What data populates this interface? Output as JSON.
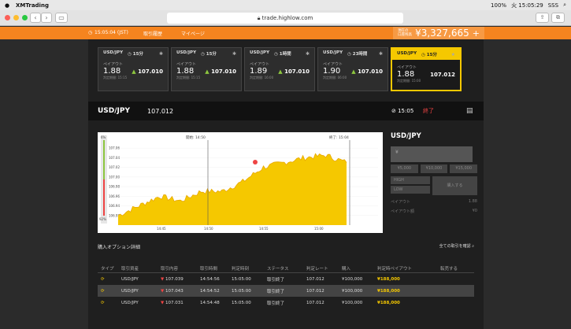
{
  "mac": {
    "app_name": "XMTrading",
    "status_battery": "100%",
    "status_date": "火 15:05:29",
    "status_user": "SSS"
  },
  "browser": {
    "url": "trade.highlow.com"
  },
  "topbar": {
    "time": "15:05:04 (JST)",
    "history": "取引履歴",
    "mypage": "マイページ",
    "balance_label_1": "現在の",
    "balance_label_2": "口座残高",
    "balance_value": "¥3,327,665",
    "add": "+"
  },
  "cards": [
    {
      "pair": "USD/JPY",
      "period": "15分",
      "label": "ペイアウト",
      "payout": "1.88",
      "rate": "107.010",
      "sub": "判定期間: 15:15"
    },
    {
      "pair": "USD/JPY",
      "period": "15分",
      "label": "ペイアウト",
      "payout": "1.88",
      "rate": "107.010",
      "sub": "判定期間: 15:15"
    },
    {
      "pair": "USD/JPY",
      "period": "1時間",
      "label": "ペイアウト",
      "payout": "1.89",
      "rate": "107.010",
      "sub": "判定期間: 16:00"
    },
    {
      "pair": "USD/JPY",
      "period": "23時間",
      "label": "ペイアウト",
      "payout": "1.90",
      "rate": "107.010",
      "sub": "判定期間: 06:00"
    },
    {
      "pair": "USD/JPY",
      "period": "15分",
      "label": "ペイアウト",
      "payout": "1.88",
      "rate": "107.012",
      "sub": "判定期間: 15:00"
    }
  ],
  "pairbar": {
    "pair": "USD/JPY",
    "rate": "107.012",
    "time": "15:05",
    "status": "終了"
  },
  "chart": {
    "start_label": "開始: 14:50",
    "end_label": "終了: 15:04",
    "pct_top": "6%",
    "pct_bottom": "92%",
    "y_ticks": [
      "107.06",
      "107.04",
      "107.02",
      "107.00",
      "106.98",
      "106.96",
      "106.94",
      "106.92"
    ],
    "x_ticks": [
      "14:45",
      "14:50",
      "14:55",
      "15:00"
    ]
  },
  "chart_data": {
    "type": "area",
    "x": [
      "14:42",
      "14:44",
      "14:46",
      "14:48",
      "14:50",
      "14:52",
      "14:54",
      "14:56",
      "14:58",
      "15:00",
      "15:02",
      "15:04"
    ],
    "y": [
      106.92,
      106.94,
      106.96,
      106.95,
      106.97,
      106.97,
      106.99,
      107.02,
      107.03,
      107.04,
      107.045,
      107.03
    ],
    "yticks": [
      "107.06",
      "107.04",
      "107.02",
      "107.00",
      "106.98",
      "106.96",
      "106.94",
      "106.92"
    ],
    "ylim": [
      106.9,
      107.07
    ]
  },
  "side": {
    "title": "USD/JPY",
    "placeholder": "¥",
    "amounts": [
      "¥5,000",
      "¥10,000",
      "¥15,000"
    ],
    "high": "HIGH",
    "low": "LOW",
    "buy": "購入する",
    "payout_label": "ペイアウト",
    "payout_value": "1.88",
    "max_label": "ペイアウト額",
    "max_value": "¥0"
  },
  "section": {
    "title": "購入オプション詳細",
    "link": "全ての取引を確認"
  },
  "table": {
    "headers": [
      "タイプ",
      "取引資産",
      "取引内容",
      "取引時間",
      "判定時刻",
      "ステータス",
      "判定レート",
      "購入",
      "判定時ペイアウト",
      "転売する"
    ],
    "rows": [
      {
        "asset": "USD/JPY",
        "content": "107.039",
        "time": "14:54:56",
        "judge": "15:05:00",
        "status": "取引終了",
        "rate": "107.012",
        "buy": "¥100,000",
        "payout": "¥188,000"
      },
      {
        "asset": "USD/JPY",
        "content": "107.043",
        "time": "14:54:52",
        "judge": "15:05:00",
        "status": "取引終了",
        "rate": "107.012",
        "buy": "¥100,000",
        "payout": "¥188,000"
      },
      {
        "asset": "USD/JPY",
        "content": "107.031",
        "time": "14:54:48",
        "judge": "15:05:00",
        "status": "取引終了",
        "rate": "107.012",
        "buy": "¥100,000",
        "payout": "¥188,000"
      }
    ]
  }
}
